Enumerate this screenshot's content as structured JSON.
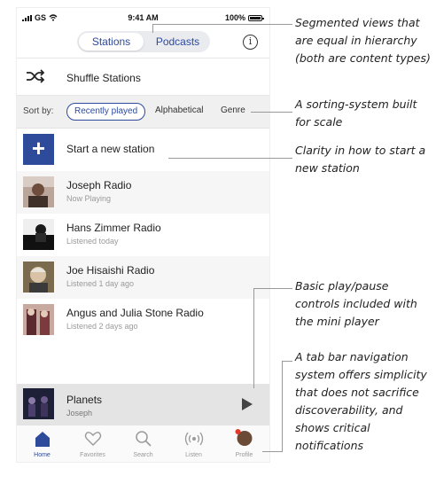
{
  "status_bar": {
    "carrier": "GS",
    "time": "9:41 AM",
    "battery": "100%"
  },
  "segment": {
    "tab_stations": "Stations",
    "tab_podcasts": "Podcasts",
    "active": "Stations"
  },
  "info_icon": "i",
  "shuffle": {
    "label": "Shuffle Stations",
    "icon": "shuffle-icon"
  },
  "sort": {
    "label": "Sort by:",
    "options": [
      "Recently played",
      "Alphabetical",
      "Genre"
    ],
    "selected": "Recently played"
  },
  "new_station": {
    "plus": "+",
    "label": "Start a new station"
  },
  "stations": [
    {
      "name": "Joseph Radio",
      "status": "Now Playing"
    },
    {
      "name": "Hans Zimmer Radio",
      "status": "Listened today"
    },
    {
      "name": "Joe Hisaishi Radio",
      "status": "Listened 1 day ago"
    },
    {
      "name": "Angus and Julia Stone Radio",
      "status": "Listened 2 days ago"
    }
  ],
  "mini_player": {
    "title": "Planets",
    "artist": "Joseph"
  },
  "tabs": [
    "Home",
    "Favorites",
    "Search",
    "Listen",
    "Profile"
  ],
  "active_tab": "Home",
  "annotations": [
    "Segmented views that are equal in hierarchy (both are content types)",
    "A sorting-system built for scale",
    "Clarity in how to start a new station",
    "Basic play/pause controls included with the mini player",
    "A tab bar navigation system offers simplicity that does not sacrifice discoverability, and shows critical notifications"
  ],
  "colors": {
    "accent": "#2d4a9b",
    "notification": "#e0392b",
    "row_alt": "#f6f6f6",
    "mini_player_bg": "#e4e4e4"
  }
}
